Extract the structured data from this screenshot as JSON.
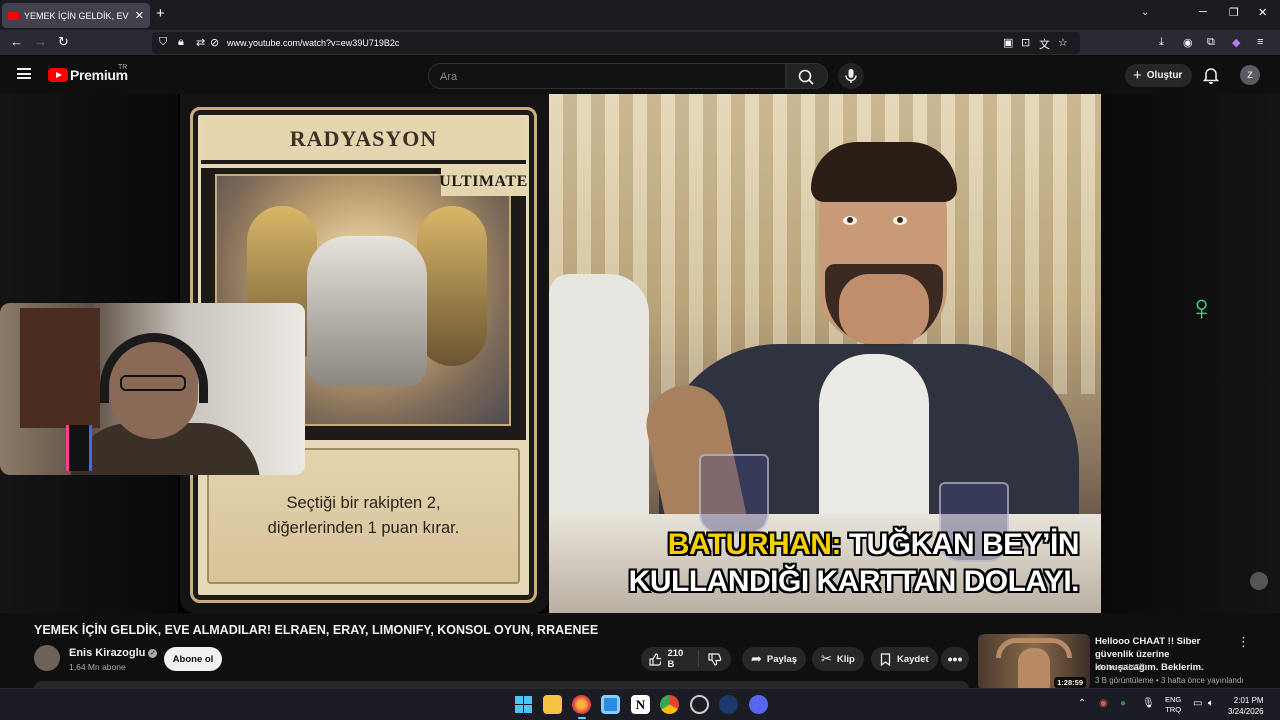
{
  "browser": {
    "tab_title": "YEMEK İÇİN GELDİK, EVE ALMADILAR! ELRAEN, ERAY, LIMONIFY, KONSOL OYUN, RRAENEE",
    "url": "www.youtube.com/watch?v=ew39U719B2c"
  },
  "masthead": {
    "logo_text": "Premium",
    "region": "TR",
    "search_placeholder": "Ara",
    "create_label": "Oluştur",
    "avatar_initial": "Z"
  },
  "video_frame": {
    "card_title": "RADYASYON",
    "card_badge": "ULTIMATE",
    "card_description": "Seçtiği bir rakipten 2, diğerlerinden 1 puan kırar.",
    "subtitle_speaker": "BATURHAN:",
    "subtitle_line1": "TUĞKAN BEY’İN",
    "subtitle_line2": "KULLANDIĞI KARTTAN DOLAYI."
  },
  "video": {
    "title": "YEMEK İÇİN GELDİK, EVE ALMADILAR! ELRAEN, ERAY, LIMONIFY, KONSOL OYUN, RRAENEE",
    "channel": "Enis Kirazoglu",
    "subscribers": "1,64 Mn abone",
    "subscribe_label": "Abone ol",
    "likes": "210 B",
    "share_label": "Paylaş",
    "clip_label": "Klip",
    "save_label": "Kaydet"
  },
  "recommendation": {
    "title": "Hellooo CHAAT !! Siber güvenlik üzerine konuşacağım. Beklerim.",
    "channel": "Mehmet INCE",
    "meta": "3 B görüntüleme • 3 hafta önce yayınlandı",
    "duration": "1:28:59"
  },
  "taskbar": {
    "lang_line1": "ENG",
    "lang_line2": "TRQ",
    "time": "2:01 PM",
    "date": "3/24/2026"
  },
  "colors": {
    "youtube_red": "#ff0000",
    "subtitle_speaker": "#f5d000",
    "brand_green": "#39d98a"
  }
}
